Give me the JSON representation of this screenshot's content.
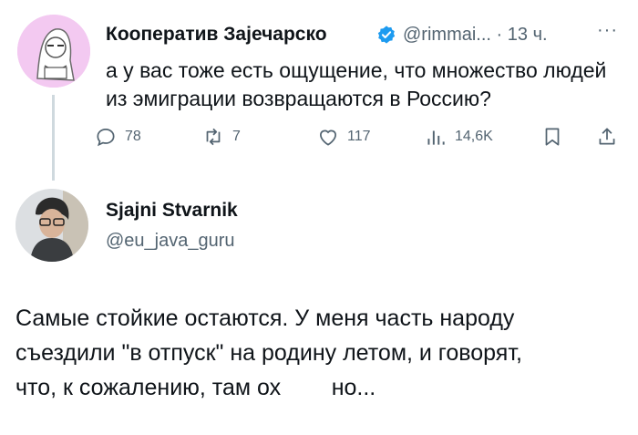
{
  "tweet1": {
    "author_name": "Кооператив Зајечарско",
    "handle": "@rimmai...",
    "time_sep": "·",
    "time": "13 ч.",
    "more": "···",
    "text": "а у вас тоже есть ощущение, что множество людей из эмиграции возвращаются в Россию?",
    "actions": {
      "replies": "78",
      "reposts": "7",
      "likes": "117",
      "views": "14,6K"
    }
  },
  "tweet2": {
    "author_name": "Sjajni Stvarnik",
    "handle": "@eu_java_guru",
    "text_lines": [
      "Самые стойкие остаются. У меня часть народу",
      "съездили \"в отпуск\" на родину летом, и говорят,",
      "что, к сожалению, там ох        но..."
    ]
  },
  "colors": {
    "text": "#0f1419",
    "secondary": "#536471",
    "verified": "#1d9bf0",
    "avatar1_bg": "#f3c9f1",
    "thread_line": "#cfd9de"
  }
}
